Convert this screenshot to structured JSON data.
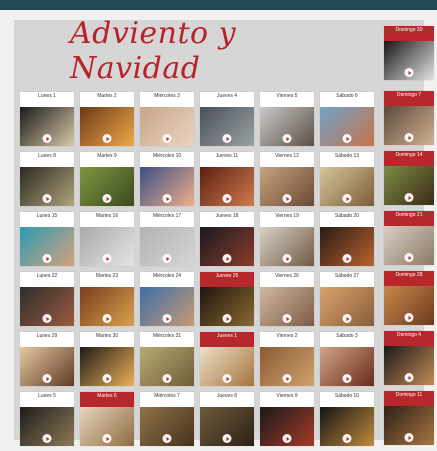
{
  "title": "Adviento y Navidad",
  "cards": [
    {
      "label": "Lunes 1",
      "red": false,
      "colors": [
        "#1a1a1a",
        "#d9c9a8"
      ]
    },
    {
      "label": "Martes 2",
      "red": false,
      "colors": [
        "#6b3a16",
        "#f0a94a"
      ]
    },
    {
      "label": "Miércoles 3",
      "red": false,
      "colors": [
        "#c8a58b",
        "#e9d5c0"
      ]
    },
    {
      "label": "Jueves 4",
      "red": false,
      "colors": [
        "#4b4f5a",
        "#9aa3a3"
      ]
    },
    {
      "label": "Viernes 5",
      "red": false,
      "colors": [
        "#c9c9c9",
        "#5d5046"
      ]
    },
    {
      "label": "Sábado 6",
      "red": false,
      "colors": [
        "#6fa3c8",
        "#c8744a"
      ]
    },
    {
      "label": "Lunes 8",
      "red": false,
      "colors": [
        "#2b2a20",
        "#b1a37c"
      ]
    },
    {
      "label": "Martes 9",
      "red": false,
      "colors": [
        "#7e9640",
        "#3b4a20"
      ]
    },
    {
      "label": "Miércoles 10",
      "red": false,
      "colors": [
        "#3a4f86",
        "#f1b088"
      ]
    },
    {
      "label": "Jueves 11",
      "red": false,
      "colors": [
        "#5b1f12",
        "#d07b4e"
      ]
    },
    {
      "label": "Viernes 12",
      "red": false,
      "colors": [
        "#c7a380",
        "#6b4a34"
      ]
    },
    {
      "label": "Sábado 13",
      "red": false,
      "colors": [
        "#d7c79b",
        "#7b5c38"
      ]
    },
    {
      "label": "Lunes 15",
      "red": false,
      "colors": [
        "#2c9bb4",
        "#d6a27c"
      ]
    },
    {
      "label": "Martes 16",
      "red": false,
      "colors": [
        "#a9a9a9",
        "#e5e5e5"
      ]
    },
    {
      "label": "Miércoles 17",
      "red": false,
      "colors": [
        "#b3b3b3",
        "#d5d5d5"
      ]
    },
    {
      "label": "Jueves 18",
      "red": false,
      "colors": [
        "#1a1a22",
        "#8a3b2a"
      ]
    },
    {
      "label": "Viernes 19",
      "red": false,
      "colors": [
        "#d9d1c4",
        "#705a46"
      ]
    },
    {
      "label": "Sábado 20",
      "red": false,
      "colors": [
        "#2a1a14",
        "#b8632e"
      ]
    },
    {
      "label": "Lunes 22",
      "red": false,
      "colors": [
        "#2d2d2d",
        "#9c5b3f"
      ]
    },
    {
      "label": "Martes 23",
      "red": false,
      "colors": [
        "#7b3c1f",
        "#d9a24c"
      ]
    },
    {
      "label": "Miércoles 24",
      "red": false,
      "colors": [
        "#3d6fa8",
        "#c79a73"
      ]
    },
    {
      "label": "Jueves 25",
      "red": true,
      "colors": [
        "#20140f",
        "#8b6a32"
      ]
    },
    {
      "label": "Viernes 26",
      "red": false,
      "colors": [
        "#d0b9a0",
        "#7d5a46"
      ]
    },
    {
      "label": "Sábado 27",
      "red": false,
      "colors": [
        "#d8a46d",
        "#8a5c3a"
      ]
    },
    {
      "label": "Lunes 29",
      "red": false,
      "colors": [
        "#e8c7a2",
        "#5d3b25"
      ]
    },
    {
      "label": "Martes 30",
      "red": false,
      "colors": [
        "#1f1a15",
        "#ecb15b"
      ]
    },
    {
      "label": "Miércoles 31",
      "red": false,
      "colors": [
        "#b9aa72",
        "#6f5d38"
      ]
    },
    {
      "label": "Jueves 1",
      "red": true,
      "colors": [
        "#ece2c8",
        "#a6713d"
      ]
    },
    {
      "label": "Viernes 2",
      "red": false,
      "colors": [
        "#8a5b34",
        "#d1a26d"
      ]
    },
    {
      "label": "Sábado 3",
      "red": false,
      "colors": [
        "#d0a484",
        "#6a2b1c"
      ]
    },
    {
      "label": "Lunes 5",
      "red": false,
      "colors": [
        "#1c1c1c",
        "#8f7a55"
      ]
    },
    {
      "label": "Martes 6",
      "red": true,
      "colors": [
        "#e7d8bd",
        "#8f6a42"
      ]
    },
    {
      "label": "Miércoles 7",
      "red": false,
      "colors": [
        "#8f7348",
        "#46331d"
      ]
    },
    {
      "label": "Jueves 8",
      "red": false,
      "colors": [
        "#6d5a3d",
        "#2e2014"
      ]
    },
    {
      "label": "Viernes 9",
      "red": false,
      "colors": [
        "#1a1a1a",
        "#a33a2a"
      ]
    },
    {
      "label": "Sábado 10",
      "red": false,
      "colors": [
        "#141414",
        "#c08a3e"
      ]
    }
  ],
  "sundays": [
    {
      "label": "Domingo 30",
      "colors": [
        "#161616",
        "#e3e3e3"
      ]
    },
    {
      "label": "Domingo 7",
      "colors": [
        "#5b4a3b",
        "#d2b190"
      ]
    },
    {
      "label": "Domingo 14",
      "colors": [
        "#7b8d43",
        "#3c2a18"
      ]
    },
    {
      "label": "Domingo 21",
      "colors": [
        "#d9cfc2",
        "#8b7a66"
      ]
    },
    {
      "label": "Domingo 28",
      "colors": [
        "#c9884a",
        "#6b3a1e"
      ]
    },
    {
      "label": "Domingo 4",
      "colors": [
        "#1b1b1b",
        "#c38a54"
      ]
    },
    {
      "label": "Domingo 11",
      "colors": [
        "#2d2014",
        "#a87542"
      ]
    }
  ]
}
